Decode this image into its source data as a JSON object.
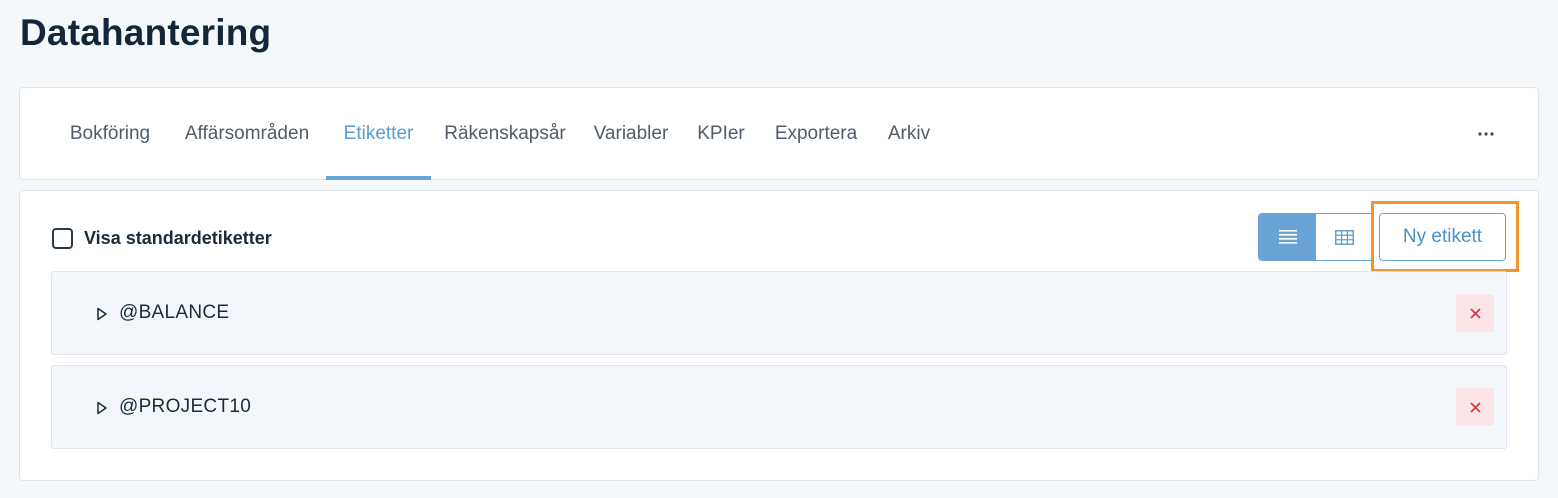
{
  "page": {
    "title": "Datahantering"
  },
  "tabs": [
    {
      "label": "Bokföring",
      "active": false
    },
    {
      "label": "Affärsområden",
      "active": false
    },
    {
      "label": "Etiketter",
      "active": true
    },
    {
      "label": "Räkenskapsår",
      "active": false
    },
    {
      "label": "Variabler",
      "active": false
    },
    {
      "label": "KPIer",
      "active": false
    },
    {
      "label": "Exportera",
      "active": false
    },
    {
      "label": "Arkiv",
      "active": false
    }
  ],
  "toolbar": {
    "show_standard_label": "Visa standardetiketter",
    "show_standard_checked": false,
    "view_modes": [
      "list-icon",
      "grid-icon"
    ],
    "active_view": "list",
    "new_label_button": "Ny etikett"
  },
  "labels": [
    {
      "name": "@BALANCE"
    },
    {
      "name": "@PROJECT10"
    }
  ],
  "colors": {
    "accent": "#6aa4d6",
    "highlight": "#f0952f",
    "danger": "#d9394a",
    "danger_bg": "#fae4e6"
  }
}
